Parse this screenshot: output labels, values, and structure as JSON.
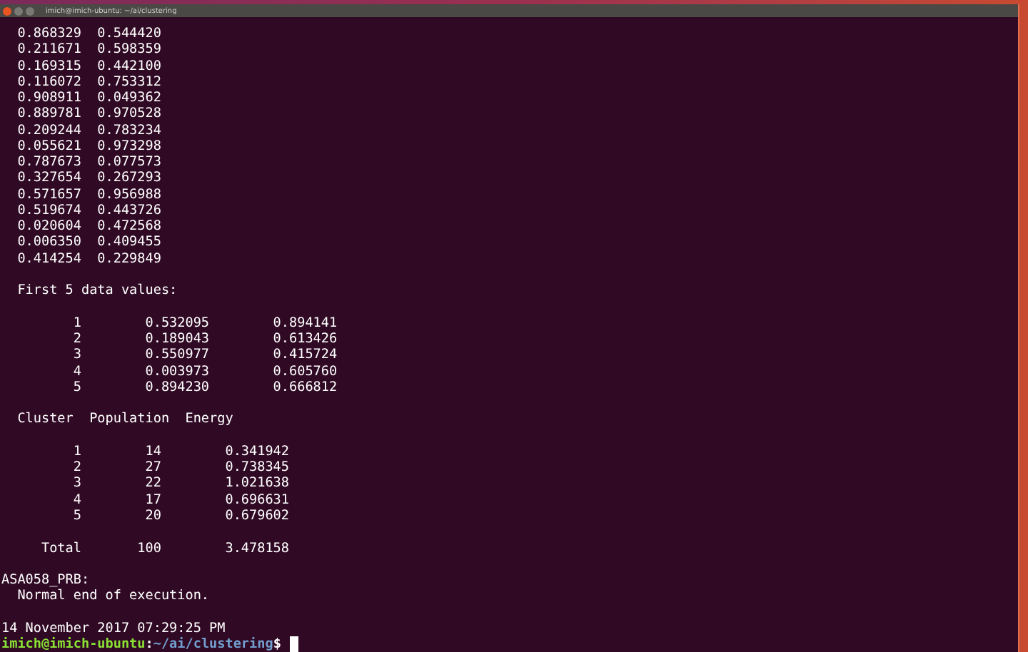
{
  "window": {
    "title": "imich@imich-ubuntu: ~/ai/clustering"
  },
  "blocks": [
    {
      "lines": [
        "  0.868329  0.544420",
        "  0.211671  0.598359",
        "  0.169315  0.442100",
        "  0.116072  0.753312",
        "  0.908911  0.049362",
        "  0.889781  0.970528",
        "  0.209244  0.783234",
        "  0.055621  0.973298",
        "  0.787673  0.077573",
        "  0.327654  0.267293",
        "  0.571657  0.956988",
        "  0.519674  0.443726",
        "  0.020604  0.472568",
        "  0.006350  0.409455",
        "  0.414254  0.229849"
      ]
    },
    {
      "lines": [
        "  First 5 data values:"
      ]
    },
    {
      "lines": [
        "         1        0.532095        0.894141",
        "         2        0.189043        0.613426",
        "         3        0.550977        0.415724",
        "         4        0.003973        0.605760",
        "         5        0.894230        0.666812"
      ]
    },
    {
      "lines": [
        "  Cluster  Population  Energy"
      ]
    },
    {
      "lines": [
        "         1        14        0.341942",
        "         2        27        0.738345",
        "         3        22        1.021638",
        "         4        17        0.696631",
        "         5        20        0.679602"
      ]
    },
    {
      "lines": [
        "     Total       100        3.478158"
      ]
    },
    {
      "lines": [
        "ASA058_PRB:",
        "  Normal end of execution."
      ]
    },
    {
      "lines": [
        "14 November 2017 07:29:25 PM"
      ]
    }
  ],
  "prompt": {
    "user_host": "imich@imich-ubuntu",
    "separator": ":",
    "path": "~/ai/clustering",
    "symbol": "$ "
  }
}
